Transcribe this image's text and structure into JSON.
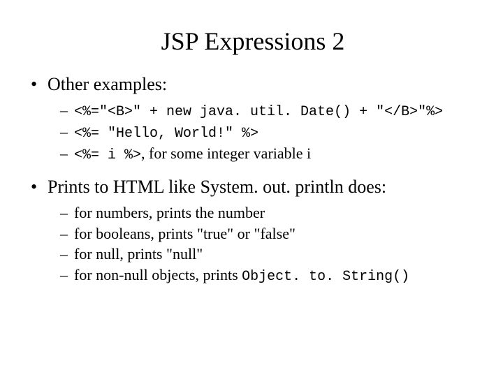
{
  "title": "JSP Expressions 2",
  "bullets": {
    "b1": {
      "label": "Other examples:",
      "items": [
        "<%=\"<B>\" + new java. util. Date() + \"</B>\"%>",
        "<%= \"Hello, World!\" %>",
        "<%= i %>"
      ],
      "item3_suffix": ", for some integer variable i"
    },
    "b2": {
      "label": "Prints to HTML like System. out. println does:",
      "items": [
        "for numbers, prints the number",
        "for booleans, prints \"true\" or \"false\"",
        "for null, prints \"null\"",
        "for non-null objects, prints "
      ],
      "item4_code": "Object. to. String()"
    }
  }
}
